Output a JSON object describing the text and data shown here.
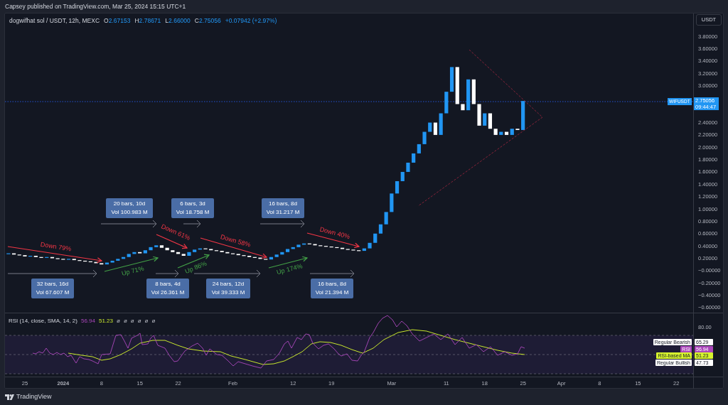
{
  "publish_note": "Capsey published on TradingView.com, Mar 25, 2024 15:15 UTC+1",
  "legend": {
    "symbol": "dogwifhat sol / USDT, 12h, MEXC",
    "ohlc": [
      {
        "label": "O",
        "value": "2.67153"
      },
      {
        "label": "H",
        "value": "2.78671"
      },
      {
        "label": "L",
        "value": "2.66000"
      },
      {
        "label": "C",
        "value": "2.75056"
      }
    ],
    "change": "+0.07942 (+2.97%)"
  },
  "currency_button": "USDT",
  "last_price": {
    "symbol_tag": "WIFUSDT",
    "value": "2.75056",
    "countdown": "09:44:47"
  },
  "price_axis": [
    "3.80000",
    "3.60000",
    "3.40000",
    "3.20000",
    "3.00000",
    "2.40000",
    "2.20000",
    "2.00000",
    "1.80000",
    "1.60000",
    "1.40000",
    "1.20000",
    "1.00000",
    "0.80000",
    "0.60000",
    "0.40000",
    "0.20000",
    "−0.00000",
    "−0.20000",
    "−0.40000",
    "−0.60000"
  ],
  "time_axis": [
    "25",
    "2024",
    "8",
    "15",
    "22",
    "Feb",
    "12",
    "19",
    "Mar",
    "11",
    "18",
    "25",
    "Apr",
    "8",
    "15",
    "22"
  ],
  "measurements": [
    {
      "bars": "20 bars, 10d",
      "volume": "Vol 100.983 M"
    },
    {
      "bars": "6 bars, 3d",
      "volume": "Vol 18.758 M"
    },
    {
      "bars": "16 bars, 8d",
      "volume": "Vol 31.217 M"
    },
    {
      "bars": "32 bars, 16d",
      "volume": "Vol 67.607 M"
    },
    {
      "bars": "8 bars, 4d",
      "volume": "Vol 26.361 M"
    },
    {
      "bars": "24 bars, 12d",
      "volume": "Vol 39.333 M"
    },
    {
      "bars": "16 bars, 8d",
      "volume": "Vol 21.394 M"
    }
  ],
  "trends": [
    {
      "kind": "down",
      "text": "Down 79%"
    },
    {
      "kind": "up",
      "text": "Up 71%"
    },
    {
      "kind": "down",
      "text": "Down 61%"
    },
    {
      "kind": "up",
      "text": "Up 86%"
    },
    {
      "kind": "down",
      "text": "Down 58%"
    },
    {
      "kind": "up",
      "text": "Up 174%"
    },
    {
      "kind": "down",
      "text": "Down 40%"
    }
  ],
  "rsi": {
    "title": "RSI (14, close, SMA, 14, 2)",
    "values": [
      "56.94",
      "51.23"
    ],
    "empty_values": [
      "ø",
      "ø",
      "ø",
      "ø",
      "ø",
      "ø"
    ],
    "axis_label": "80.00",
    "badges": [
      {
        "label": "Regular Bearish",
        "value": "65.29",
        "color": "#ffffff"
      },
      {
        "label": "RSI",
        "value": "56.94",
        "color": "#ab47bc"
      },
      {
        "label": "RSI-based MA",
        "value": "51.23",
        "color": "#d7f52e"
      },
      {
        "label": "Regular Bullish",
        "value": "47.73",
        "color": "#ffffff"
      }
    ]
  },
  "footer": {
    "brand": "TradingView"
  }
}
